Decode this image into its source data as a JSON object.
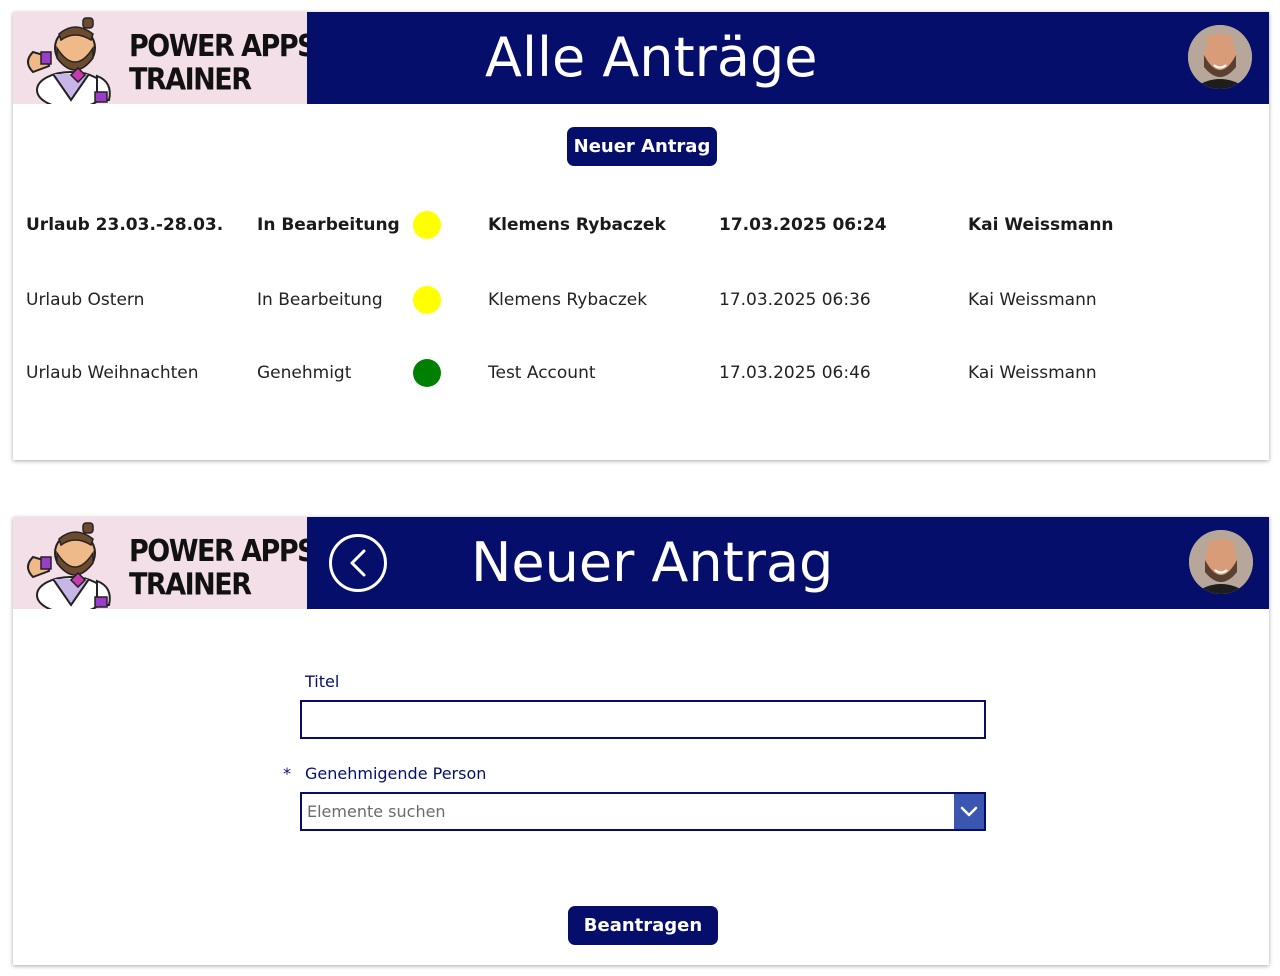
{
  "brand": {
    "line1": "POWER APPS",
    "line2": "TRAINER"
  },
  "colors": {
    "header_bg": "#050f6b",
    "logo_bg": "#f3dfe8",
    "status_in_progress": "#ffff00",
    "status_approved": "#008000",
    "dropdown_button": "#3a56b0"
  },
  "list_screen": {
    "title": "Alle Anträge",
    "new_button_label": "Neuer Antrag",
    "rows": [
      {
        "title": "Urlaub 23.03.-28.03.",
        "status": "In Bearbeitung",
        "status_color": "#ffff00",
        "creator": "Klemens Rybaczek",
        "date": "17.03.2025 06:24",
        "approver": "Kai Weissmann",
        "selected": true
      },
      {
        "title": "Urlaub Ostern",
        "status": "In Bearbeitung",
        "status_color": "#ffff00",
        "creator": "Klemens Rybaczek",
        "date": "17.03.2025 06:36",
        "approver": "Kai Weissmann",
        "selected": false
      },
      {
        "title": "Urlaub Weihnachten",
        "status": "Genehmigt",
        "status_color": "#008000",
        "creator": "Test Account",
        "date": "17.03.2025 06:46",
        "approver": "Kai Weissmann",
        "selected": false
      }
    ]
  },
  "form_screen": {
    "title": "Neuer Antrag",
    "title_field": {
      "label": "Titel",
      "value": ""
    },
    "approver_field": {
      "required_mark": "*",
      "label": "Genehmigende Person",
      "placeholder": "Elemente suchen",
      "value": ""
    },
    "submit_label": "Beantragen"
  },
  "icons": {
    "back": "back-arrow-circle-icon",
    "dropdown": "chevron-down-icon",
    "avatar": "user-avatar"
  }
}
